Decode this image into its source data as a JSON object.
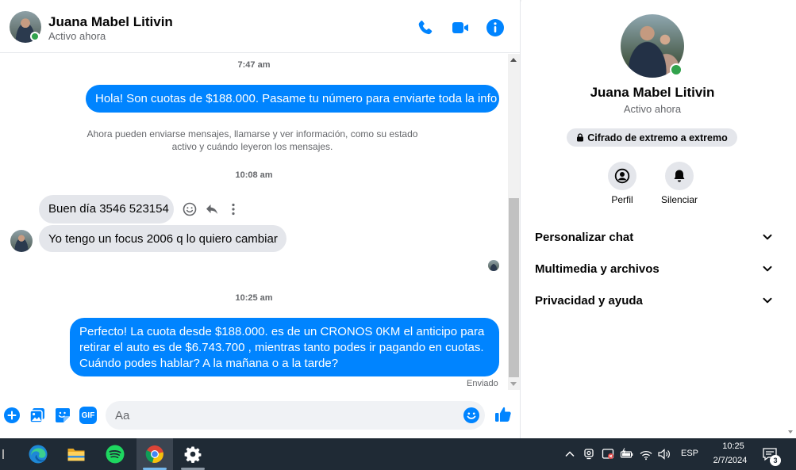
{
  "contact": {
    "name": "Juana Mabel Litivin",
    "status": "Activo ahora"
  },
  "header": {
    "call_icon": "phone-icon",
    "video_icon": "video-camera-icon",
    "info_icon": "info-icon"
  },
  "messages": {
    "ts1": "7:47 am",
    "msg1": "Hola! Son cuotas de $188.000. Pasame tu número para enviarte toda la info",
    "system_note": "Ahora pueden enviarse mensajes, llamarse y ver información, como su estado activo y cuándo leyeron los mensajes.",
    "ts2": "10:08 am",
    "msg2": "Buen día 3546 523154",
    "msg3": "Yo tengo un focus 2006 q lo quiero cambiar",
    "ts3": "10:25 am",
    "msg4": "Perfecto! La cuota desde $188.000. es de un CRONOS 0KM el anticipo para retirar el auto es de $6.743.700 , mientras tanto podes ir pagando en cuotas. Cuándo podes hablar? A la mañana o a la tarde?",
    "sent_status": "Enviado"
  },
  "composer": {
    "placeholder": "Aa",
    "gif_label": "GIF"
  },
  "sidebar": {
    "name": "Juana Mabel Litivin",
    "status": "Activo ahora",
    "e2e_label": "Cifrado de extremo a extremo",
    "profile_label": "Perfil",
    "mute_label": "Silenciar",
    "sections": [
      {
        "label": "Personalizar chat"
      },
      {
        "label": "Multimedia y archivos"
      },
      {
        "label": "Privacidad y ayuda"
      }
    ]
  },
  "taskbar": {
    "language": "ESP",
    "time": "10:25",
    "date": "2/7/2024",
    "notifications": "3"
  },
  "colors": {
    "accent": "#0084ff",
    "online": "#31a24c",
    "taskbar": "#1f2a35"
  }
}
